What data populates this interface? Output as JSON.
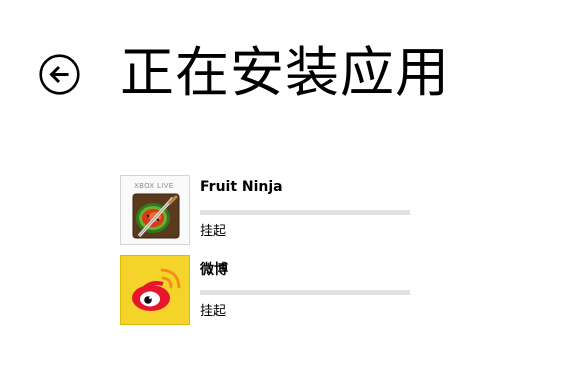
{
  "header": {
    "title": "正在安装应用",
    "back_icon": "back-arrow-circle-icon"
  },
  "apps": [
    {
      "name": "Fruit Ninja",
      "status": "挂起",
      "badge": "XBOX LIVE",
      "icon": "fruit-ninja-icon",
      "progress": 0
    },
    {
      "name": "微博",
      "status": "挂起",
      "icon": "weibo-icon",
      "progress": 0
    }
  ],
  "colors": {
    "background": "#ffffff",
    "text": "#000000",
    "progress_track": "#e1e1e1",
    "weibo_tile": "#f4d42a"
  }
}
